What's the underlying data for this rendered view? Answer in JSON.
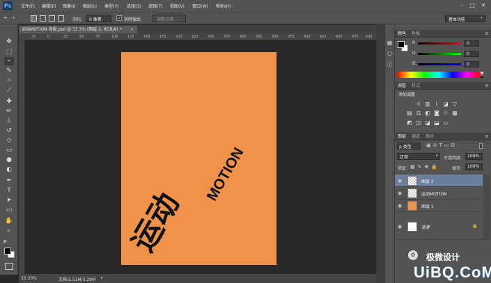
{
  "app": {
    "logo": "Ps"
  },
  "menu": [
    "文件(F)",
    "编辑(E)",
    "图像(I)",
    "图层(L)",
    "类型(Y)",
    "选择(S)",
    "滤镜(T)",
    "视图(V)",
    "窗口(W)",
    "帮助(H)"
  ],
  "options": {
    "feather_label": "羽化:",
    "feather_value": "0 像素",
    "antialias_label": "消除锯齿",
    "refine_edge": "调整边缘...",
    "workspace": "基本功能"
  },
  "document": {
    "tab_title": "运动MOTION 海报.psd @ 33.3% (图层 2, RGB/8) *",
    "ruler_ticks": [
      "25",
      "0",
      "25",
      "50",
      "75",
      "100",
      "125",
      "150",
      "175",
      "200",
      "225",
      "250",
      "275",
      "300",
      "325",
      "350",
      "375",
      "400",
      "425",
      "450",
      "475",
      "500"
    ],
    "art_cn": "运动",
    "art_en": "MOTION",
    "art_bg": "#f0924a"
  },
  "status": {
    "zoom": "33.33%",
    "doc_size": "文档:5.51M/3.29M"
  },
  "color_panel": {
    "tabs": [
      "颜色",
      "色板"
    ],
    "channels": [
      {
        "label": "R",
        "value": "0"
      },
      {
        "label": "G",
        "value": "0"
      },
      {
        "label": "B",
        "value": "0"
      }
    ]
  },
  "adjust_panel": {
    "tabs": [
      "调整",
      "样式"
    ],
    "title": "添加调整"
  },
  "layers_panel": {
    "tabs": [
      "图层",
      "通道",
      "路径"
    ],
    "filter": "ρ 类型",
    "blend_mode": "正常",
    "opacity_label": "不透明度:",
    "opacity_value": "100%",
    "lock_label": "锁定:",
    "fill_label": "填充:",
    "fill_value": "100%",
    "layers": [
      {
        "name": "图层 2",
        "thumb": "checker",
        "selected": true
      },
      {
        "name": "运动MOTION",
        "thumb": "checker",
        "selected": false
      },
      {
        "name": "图层 1",
        "thumb": "#f0924a",
        "selected": false
      },
      {
        "name": "背景",
        "thumb": "#ffffff",
        "selected": false
      }
    ]
  },
  "watermark": {
    "brand": "极微设计",
    "site": "UiBQ.CoM"
  }
}
